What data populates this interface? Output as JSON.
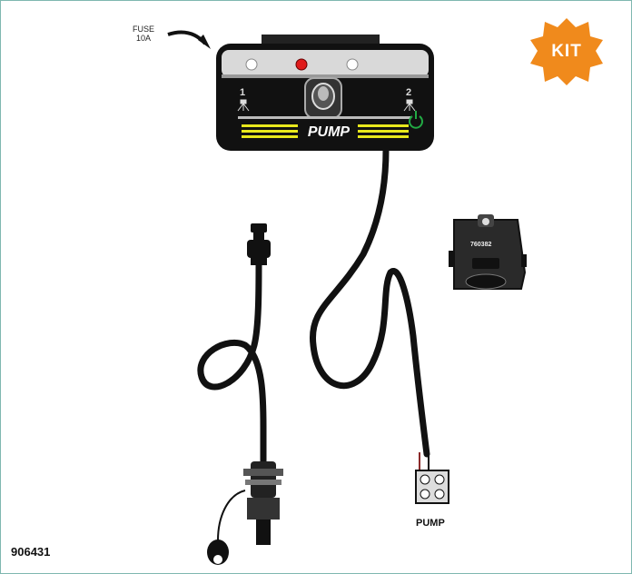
{
  "figure": {
    "fuse_label_line1": "FUSE",
    "fuse_label_line2": "10A",
    "badge_text": "KIT",
    "badge_color": "#f08a1c",
    "switch_label": "PUMP",
    "position_1": "1",
    "position_2": "2",
    "adapter_code": "760382",
    "wire_label": "PUMP",
    "part_number": "906431",
    "led_colors": [
      "#ffffff",
      "#e01b1b",
      "#ffffff"
    ],
    "power_icon_color": "#22aa44",
    "stripe_color": "#e8e81c"
  }
}
